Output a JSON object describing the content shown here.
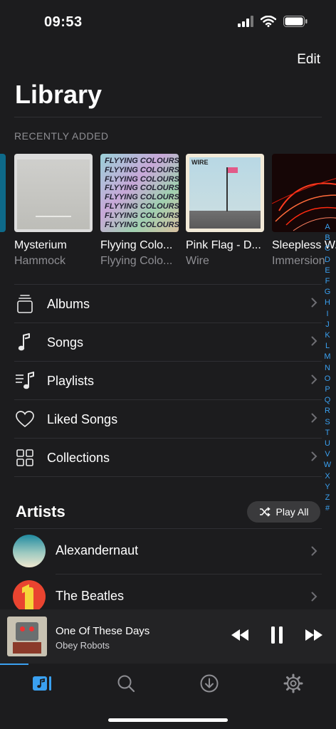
{
  "status": {
    "time": "09:53"
  },
  "header": {
    "edit_label": "Edit",
    "title": "Library"
  },
  "recently_added": {
    "label": "RECENTLY ADDED",
    "albums": [
      {
        "title": "Mysterium",
        "artist": "Hammock"
      },
      {
        "title": "Flyying Colo...",
        "artist": "Flyying Colo...",
        "art_text": [
          "FLYYING COLOURS",
          "FLYYING COLOURS",
          "FLYYING COLOURS",
          "FLYYING COLOURS",
          "FLYYING COLOURS",
          "FLYYING COLOURS",
          "FLYYING COLOURS",
          "FLYYING COLOURS"
        ]
      },
      {
        "title": "Pink Flag - D...",
        "artist": "Wire",
        "art_text": "WIRE"
      },
      {
        "title": "Sleepless W...",
        "artist": "Immersion"
      }
    ]
  },
  "menu": {
    "items": [
      {
        "label": "Albums",
        "icon": "albums-stack-icon"
      },
      {
        "label": "Songs",
        "icon": "music-note-icon"
      },
      {
        "label": "Playlists",
        "icon": "playlist-icon"
      },
      {
        "label": "Liked Songs",
        "icon": "heart-icon"
      },
      {
        "label": "Collections",
        "icon": "grid-icon"
      }
    ]
  },
  "alpha_index": [
    "A",
    "B",
    "C",
    "D",
    "E",
    "F",
    "G",
    "H",
    "I",
    "J",
    "K",
    "L",
    "M",
    "N",
    "O",
    "P",
    "Q",
    "R",
    "S",
    "T",
    "U",
    "V",
    "W",
    "X",
    "Y",
    "Z",
    "#"
  ],
  "artists": {
    "title": "Artists",
    "play_all_label": "Play All",
    "items": [
      {
        "name": "Alexandernaut"
      },
      {
        "name": "The Beatles"
      }
    ]
  },
  "now_playing": {
    "title": "One Of These Days",
    "artist": "Obey Robots"
  },
  "tabs": [
    {
      "name": "library",
      "icon": "library-icon",
      "active": true
    },
    {
      "name": "search",
      "icon": "search-icon",
      "active": false
    },
    {
      "name": "downloads",
      "icon": "download-icon",
      "active": false
    },
    {
      "name": "settings",
      "icon": "gear-icon",
      "active": false
    }
  ],
  "colors": {
    "accent": "#3aa0f0",
    "background": "#1c1c1e",
    "secondary_text": "#8e8e93"
  }
}
